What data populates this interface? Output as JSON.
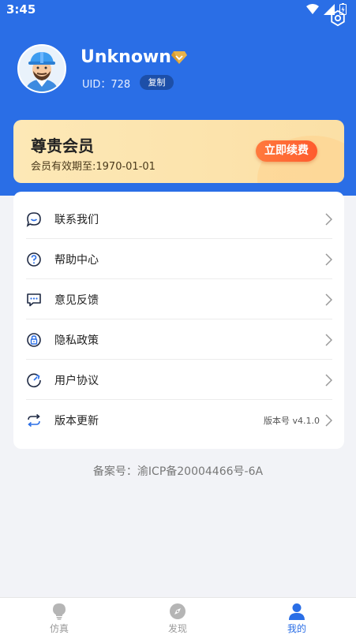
{
  "status_bar": {
    "time": "3:45"
  },
  "profile": {
    "username": "Unknown",
    "uid_label": "UID：728",
    "copy_label": "复制"
  },
  "vip": {
    "title": "尊贵会员",
    "expiry": "会员有效期至:1970-01-01",
    "renew_label": "立即续费"
  },
  "menu": {
    "items": [
      {
        "label": "联系我们",
        "icon": "chat-icon"
      },
      {
        "label": "帮助中心",
        "icon": "help-icon"
      },
      {
        "label": "意见反馈",
        "icon": "feedback-icon"
      },
      {
        "label": "隐私政策",
        "icon": "privacy-lock-icon"
      },
      {
        "label": "用户协议",
        "icon": "agreement-icon"
      },
      {
        "label": "版本更新",
        "icon": "update-icon",
        "extra": "版本号 v4.1.0"
      }
    ]
  },
  "icp": "备案号：渝ICP备20004466号-6A",
  "tabs": [
    {
      "label": "仿真",
      "icon": "lightbulb-icon",
      "active": false
    },
    {
      "label": "发现",
      "icon": "compass-icon",
      "active": false
    },
    {
      "label": "我的",
      "icon": "user-icon",
      "active": true
    }
  ],
  "colors": {
    "primary": "#2a6ee6",
    "accent_orange": "#ff5b2e",
    "inactive": "#9a9a9a"
  }
}
